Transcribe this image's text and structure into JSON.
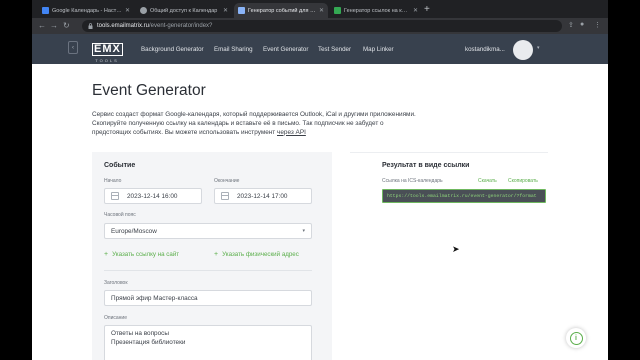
{
  "browser": {
    "tabs": [
      {
        "title": "Google Календарь - Настро",
        "favicon_color": "#4285f4"
      },
      {
        "title": "Общий доступ к Календар",
        "favicon_color": "#9aa0a6"
      },
      {
        "title": "Генератор событий для Goo",
        "favicon_color": "#8ab4f8"
      },
      {
        "title": "Генератор ссылок на календ",
        "favicon_color": "#34a853"
      }
    ],
    "new_tab": "+",
    "url_host": "tools.emailmatrix.ru",
    "url_path": "/event-generator/index?"
  },
  "site": {
    "logo": "EMX",
    "logo_sub": "TOOLS",
    "nav": [
      "Background Generator",
      "Email Sharing",
      "Event Generator",
      "Test Sender",
      "Map Linker"
    ],
    "user": "kostandikma..."
  },
  "page": {
    "title": "Event Generator",
    "description_1": "Сервис создаст формат Google-календаря, который поддерживается Outlook, iCal и другими приложениями.",
    "description_2": "Скопируйте полученную ссылку на календарь и вставьте её в письмо. Так подписчик не забудет о",
    "description_3": "предстоящих событиях. Вы можете использовать инструмент ",
    "description_link": "через API"
  },
  "event": {
    "heading": "Событие",
    "start_label": "Начало",
    "start_value": "2023-12-14 16:00",
    "end_label": "Окончание",
    "end_value": "2023-12-14 17:00",
    "tz_label": "Часовой пояс",
    "tz_value": "Europe/Moscow",
    "add_site_link": "Указать ссылку на сайт",
    "add_address": "Указать физический адрес",
    "title_label": "Заголовок",
    "title_value": "Прямой эфир Мастер-класса",
    "desc_label": "Описание",
    "desc_line1": "Ответы на вопросы",
    "desc_line2": "Презентация библиотеки"
  },
  "result": {
    "heading": "Результат в виде ссылки",
    "ics_label": "Ссылка на ICS-календарь",
    "download": "Скачать",
    "copy": "Скопировать",
    "link": "https://tools.emailmatrix.ru/event-generator/?format"
  }
}
